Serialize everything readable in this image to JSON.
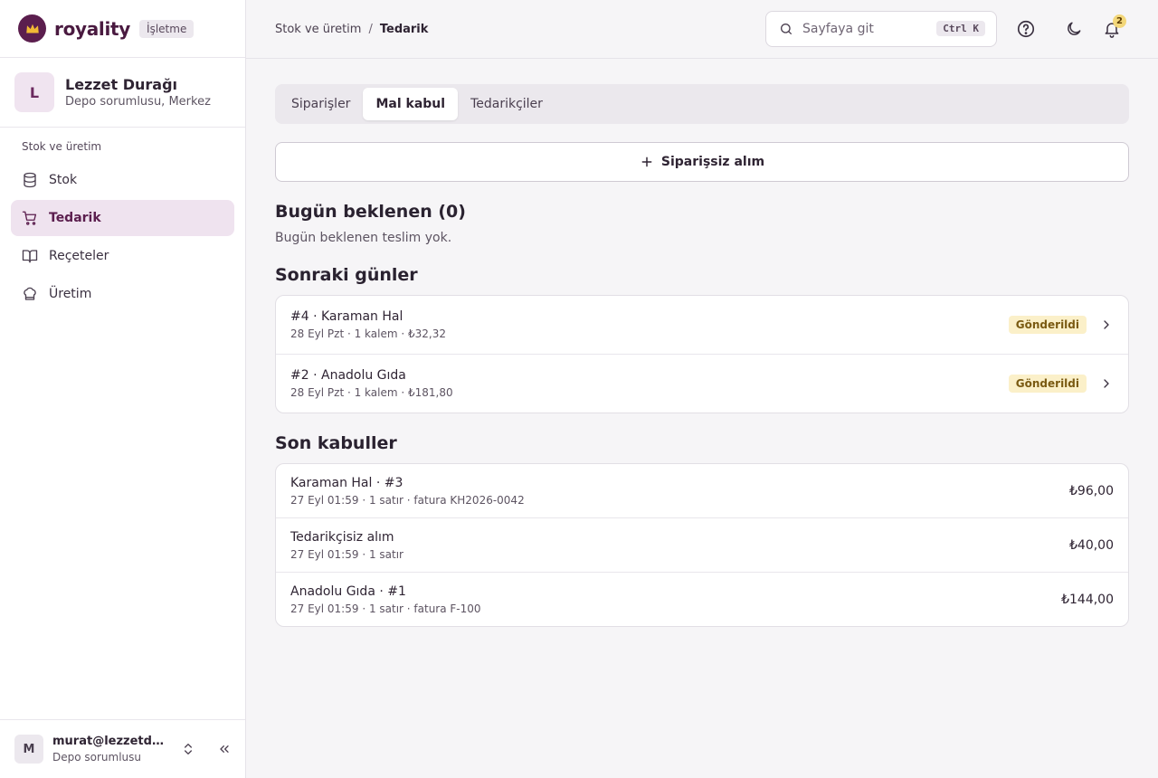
{
  "brand": {
    "name": "royality",
    "badge": "İşletme",
    "colors": {
      "primary": "#5b1e4e",
      "crown": "#f2b935"
    }
  },
  "org": {
    "initial": "L",
    "name": "Lezzet Durağı",
    "role": "Depo sorumlusu, Merkez"
  },
  "nav": {
    "group_title": "Stok ve üretim",
    "items": [
      {
        "label": "Stok",
        "icon": "database-icon",
        "active": false
      },
      {
        "label": "Tedarik",
        "icon": "cart-icon",
        "active": true
      },
      {
        "label": "Reçeteler",
        "icon": "book-icon",
        "active": false
      },
      {
        "label": "Üretim",
        "icon": "chef-hat-icon",
        "active": false
      }
    ]
  },
  "user": {
    "initial": "M",
    "email": "murat@lezzetdurağı.com",
    "role": "Depo sorumlusu"
  },
  "topbar": {
    "breadcrumb": {
      "parent": "Stok ve üretim",
      "separator": "/",
      "current": "Tedarik"
    },
    "search": {
      "placeholder": "Sayfaya git",
      "shortcut": "Ctrl K"
    },
    "notifications_count": "2"
  },
  "tabs": [
    {
      "label": "Siparişler",
      "active": false
    },
    {
      "label": "Mal kabul",
      "active": true
    },
    {
      "label": "Tedarikçiler",
      "active": false
    }
  ],
  "add_button": {
    "label": "Siparişsiz alım"
  },
  "today": {
    "title": "Bugün beklenen (0)",
    "empty_text": "Bugün beklenen teslim yok."
  },
  "upcoming": {
    "title": "Sonraki günler",
    "items": [
      {
        "title": "#4 · Karaman Hal",
        "subtitle": "28 Eyl Pzt · 1 kalem · ₺32,32",
        "status": "Gönderildi"
      },
      {
        "title": "#2 · Anadolu Gıda",
        "subtitle": "28 Eyl Pzt · 1 kalem · ₺181,80",
        "status": "Gönderildi"
      }
    ]
  },
  "recent": {
    "title": "Son kabuller",
    "items": [
      {
        "title": "Karaman Hal · #3",
        "subtitle": "27 Eyl 01:59 · 1 satır · fatura KH2026-0042",
        "amount": "₺96,00"
      },
      {
        "title": "Tedarikçisiz alım",
        "subtitle": "27 Eyl 01:59 · 1 satır",
        "amount": "₺40,00"
      },
      {
        "title": "Anadolu Gıda · #1",
        "subtitle": "27 Eyl 01:59 · 1 satır · fatura F-100",
        "amount": "₺144,00"
      }
    ]
  }
}
